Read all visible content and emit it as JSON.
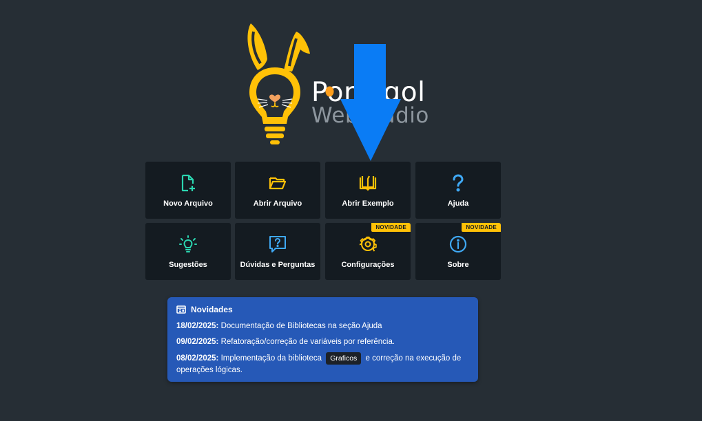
{
  "logo": {
    "text_line_1": "Portugol",
    "text_line_2": "WebStudio"
  },
  "tiles": [
    {
      "label": "Novo Arquivo",
      "icon": "new-file-icon",
      "color": "#2bd6b0"
    },
    {
      "label": "Abrir Arquivo",
      "icon": "folder-open-icon",
      "color": "#ffc107"
    },
    {
      "label": "Abrir Exemplo",
      "icon": "book-open-icon",
      "color": "#ffc107"
    },
    {
      "label": "Ajuda",
      "icon": "question-icon",
      "color": "#3fa9f5"
    },
    {
      "label": "Sugestões",
      "icon": "lightbulb-icon",
      "color": "#2bd6b0"
    },
    {
      "label": "Dúvidas e Perguntas",
      "icon": "question-chat-icon",
      "color": "#3fa9f5"
    },
    {
      "label": "Configurações",
      "icon": "gear-icon",
      "color": "#ffc107",
      "badge": "NOVIDADE"
    },
    {
      "label": "Sobre",
      "icon": "info-icon",
      "color": "#3fa9f5",
      "badge": "NOVIDADE"
    }
  ],
  "news": {
    "title": "Novidades",
    "items": [
      {
        "date": "18/02/2025:",
        "text": "Documentação de Bibliotecas na seção Ajuda"
      },
      {
        "date": "09/02/2025:",
        "text": "Refatoração/correção de variáveis por referência."
      },
      {
        "date": "08/02/2025:",
        "text_before": "Implementação da biblioteca",
        "tag": "Graficos",
        "text_after": "e correção na execução de operações lógicas."
      }
    ]
  },
  "colors": {
    "background": "#262e35",
    "tile_bg": "#141b21",
    "accent_yellow": "#ffc107",
    "news_bg": "#2659b7",
    "arrow": "#0a7cf5"
  }
}
